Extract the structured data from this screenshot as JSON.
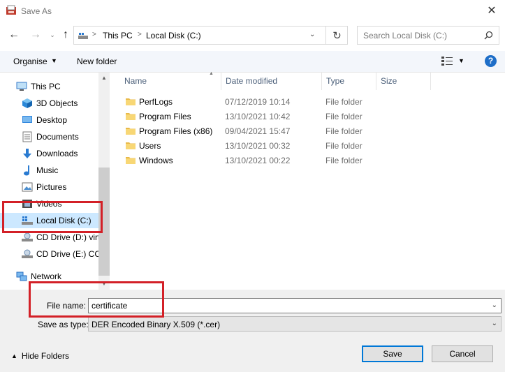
{
  "window": {
    "title": "Save As"
  },
  "nav": {
    "back_icon": "arrow-left-icon",
    "forward_icon": "arrow-right-icon",
    "recent_icon": "chevron-down-icon",
    "up_icon": "arrow-up-icon",
    "breadcrumb": [
      "This PC",
      "Local Disk (C:)"
    ],
    "search_placeholder": "Search Local Disk (C:)"
  },
  "toolbar": {
    "organise": "Organise",
    "new_folder": "New folder"
  },
  "sidebar": {
    "items": [
      {
        "label": "This PC",
        "icon": "computer-icon",
        "indent": 0
      },
      {
        "label": "3D Objects",
        "icon": "cube-icon",
        "indent": 1
      },
      {
        "label": "Desktop",
        "icon": "desktop-icon",
        "indent": 1
      },
      {
        "label": "Documents",
        "icon": "document-icon",
        "indent": 1
      },
      {
        "label": "Downloads",
        "icon": "download-icon",
        "indent": 1
      },
      {
        "label": "Music",
        "icon": "music-icon",
        "indent": 1
      },
      {
        "label": "Pictures",
        "icon": "picture-icon",
        "indent": 1
      },
      {
        "label": "Videos",
        "icon": "video-icon",
        "indent": 1
      },
      {
        "label": "Local Disk (C:)",
        "icon": "drive-icon",
        "indent": 1,
        "selected": true
      },
      {
        "label": "CD Drive (D:) virt",
        "icon": "cd-drive-icon",
        "indent": 1
      },
      {
        "label": "CD Drive (E:) CC",
        "icon": "cd-drive-icon",
        "indent": 1
      },
      {
        "label": "Network",
        "icon": "network-icon",
        "indent": 0
      }
    ]
  },
  "files": {
    "columns": [
      "Name",
      "Date modified",
      "Type",
      "Size"
    ],
    "rows": [
      {
        "name": "PerfLogs",
        "date": "07/12/2019 10:14",
        "type": "File folder"
      },
      {
        "name": "Program Files",
        "date": "13/10/2021 10:42",
        "type": "File folder"
      },
      {
        "name": "Program Files (x86)",
        "date": "09/04/2021 15:47",
        "type": "File folder"
      },
      {
        "name": "Users",
        "date": "13/10/2021 00:32",
        "type": "File folder"
      },
      {
        "name": "Windows",
        "date": "13/10/2021 00:22",
        "type": "File folder"
      }
    ]
  },
  "form": {
    "file_name_label": "File name:",
    "file_name_value": "certificate",
    "save_as_type_label": "Save as type:",
    "save_as_type_value": "DER Encoded Binary X.509 (*.cer)"
  },
  "footer": {
    "hide_folders": "Hide Folders",
    "save": "Save",
    "cancel": "Cancel"
  },
  "colors": {
    "accent": "#0078d7",
    "highlight": "#d32027",
    "selection": "#cce8ff",
    "folder": "#f8d775"
  }
}
